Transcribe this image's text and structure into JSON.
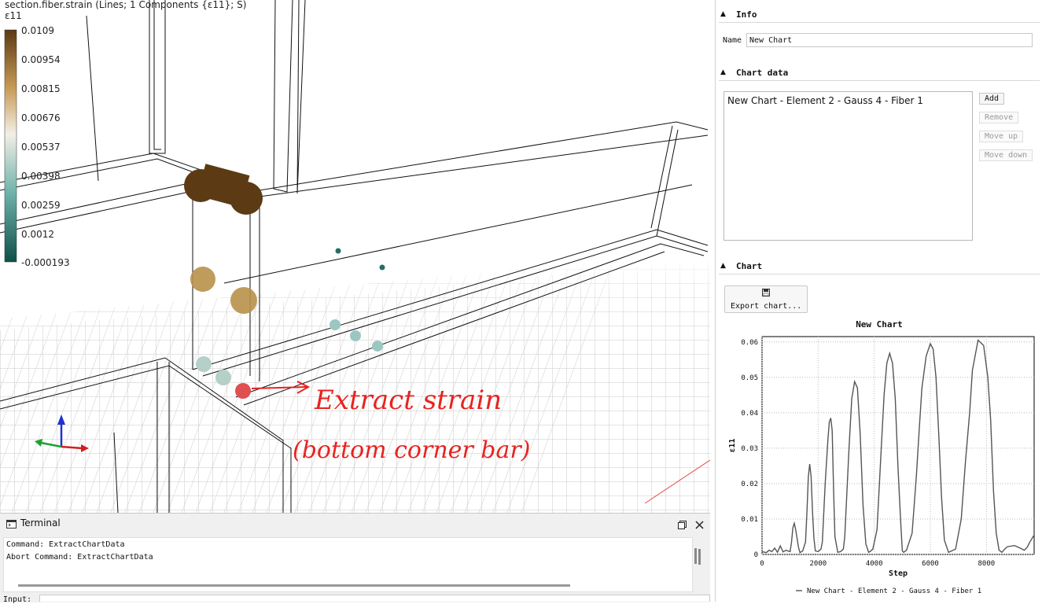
{
  "viewport": {
    "title": "section.fiber.strain (Lines; 1 Components {ε11}; S)",
    "component": "ε11",
    "colorbar_ticks": [
      "0.0109",
      "0.00954",
      "0.00815",
      "0.00676",
      "0.00537",
      "0.00398",
      "0.00259",
      "0.0012",
      "-0.000193"
    ],
    "colors": {
      "high": "#5c3a14",
      "mid": "#f3efe6",
      "low": "#0e4f4a",
      "highlight": "#e05050",
      "annotation": "#e8231e"
    }
  },
  "side_panel": {
    "info": {
      "header": "Info",
      "name_label": "Name",
      "name_value": "New Chart"
    },
    "chart_data": {
      "header": "Chart data",
      "items": [
        "New Chart - Element 2 - Gauss 4 - Fiber 1"
      ],
      "buttons": {
        "add": "Add",
        "remove": "Remove",
        "move_up": "Move up",
        "move_down": "Move down"
      }
    },
    "chart": {
      "header": "Chart",
      "export_label": "Export chart..."
    }
  },
  "chart_data": {
    "type": "line",
    "title": "New Chart",
    "xlabel": "Step",
    "ylabel": "ε11",
    "xlim": [
      0,
      9700
    ],
    "ylim": [
      0,
      0.0615
    ],
    "xticks": [
      "0",
      "2000",
      "4000",
      "6000",
      "8000"
    ],
    "yticks": [
      "0",
      "0.01",
      "0.02",
      "0.03",
      "0.04",
      "0.05",
      "0.06"
    ],
    "grid": true,
    "legend": "New Chart - Element 2 - Gauss 4 - Fiber 1",
    "series": [
      {
        "name": "New Chart - Element 2 - Gauss 4 - Fiber 1",
        "color": "#555555",
        "x": [
          0,
          150,
          250,
          350,
          450,
          550,
          650,
          750,
          850,
          1000,
          1050,
          1100,
          1150,
          1200,
          1250,
          1300,
          1350,
          1450,
          1550,
          1600,
          1650,
          1700,
          1750,
          1800,
          1850,
          1900,
          2000,
          2100,
          2150,
          2250,
          2350,
          2400,
          2450,
          2500,
          2550,
          2600,
          2700,
          2800,
          2900,
          2950,
          3100,
          3200,
          3300,
          3400,
          3500,
          3600,
          3700,
          3800,
          3850,
          3950,
          4100,
          4250,
          4350,
          4450,
          4550,
          4650,
          4750,
          4850,
          4950,
          5000,
          5050,
          5150,
          5350,
          5500,
          5600,
          5700,
          5850,
          6000,
          6100,
          6200,
          6300,
          6400,
          6500,
          6650,
          6900,
          7100,
          7250,
          7400,
          7500,
          7700,
          7900,
          8050,
          8150,
          8250,
          8350,
          8450,
          8550,
          8650,
          8750,
          9000,
          9200,
          9350,
          9450,
          9550,
          9700
        ],
        "y": [
          0.0008,
          0.0005,
          0.0012,
          0.0008,
          0.0018,
          0.0006,
          0.0024,
          0.0007,
          0.0012,
          0.0008,
          0.0035,
          0.0075,
          0.0088,
          0.007,
          0.0045,
          0.002,
          0.0005,
          0.001,
          0.0035,
          0.012,
          0.022,
          0.0255,
          0.022,
          0.012,
          0.0045,
          0.001,
          0.0008,
          0.0015,
          0.0035,
          0.02,
          0.0325,
          0.0375,
          0.0385,
          0.035,
          0.018,
          0.005,
          0.0006,
          0.0008,
          0.0015,
          0.005,
          0.03,
          0.044,
          0.0488,
          0.047,
          0.034,
          0.014,
          0.003,
          0.0006,
          0.0008,
          0.0015,
          0.007,
          0.03,
          0.045,
          0.054,
          0.0568,
          0.054,
          0.044,
          0.024,
          0.008,
          0.001,
          0.0006,
          0.0012,
          0.006,
          0.022,
          0.035,
          0.047,
          0.056,
          0.0595,
          0.058,
          0.05,
          0.034,
          0.016,
          0.004,
          0.0006,
          0.0015,
          0.01,
          0.026,
          0.04,
          0.052,
          0.0605,
          0.059,
          0.05,
          0.038,
          0.018,
          0.006,
          0.0012,
          0.0006,
          0.0015,
          0.0022,
          0.0025,
          0.0018,
          0.0012,
          0.002,
          0.0035,
          0.0055
        ]
      }
    ]
  },
  "terminal": {
    "title": "Terminal",
    "lines": [
      "Command: ExtractChartData",
      "Abort Command: ExtractChartData"
    ],
    "input_label": "Input:"
  },
  "annotation": {
    "line1": "Extract strain",
    "line2": "(bottom corner bar)"
  }
}
